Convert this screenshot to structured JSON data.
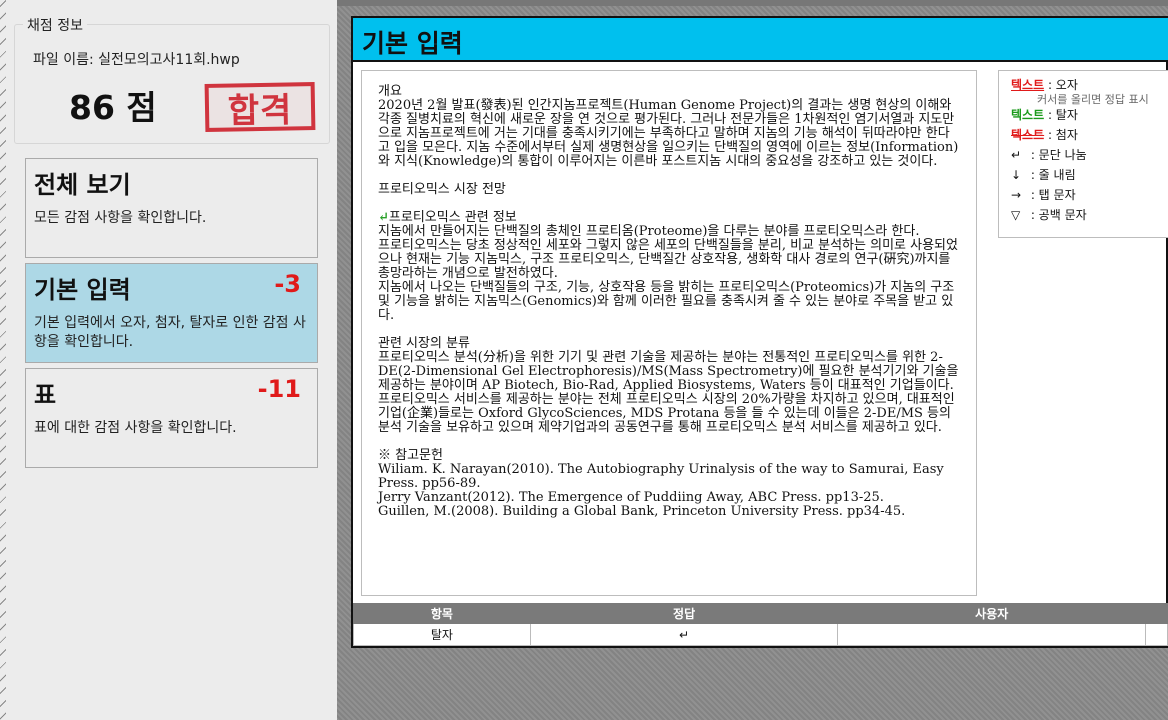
{
  "left": {
    "group_title": "채점 정보",
    "file_name": "파일 이름: 실전모의고사11회.hwp",
    "score": "86 점",
    "stamp": "합격",
    "cards": [
      {
        "title": "전체 보기",
        "penalty": "",
        "desc": "모든 감점 사항을 확인합니다."
      },
      {
        "title": "기본 입력",
        "penalty": "-3",
        "desc": "기본 입력에서 오자, 첨자, 탈자로 인한 감점 사항을 확인합니다."
      },
      {
        "title": "표",
        "penalty": "-11",
        "desc": "표에 대한 감점 사항을 확인합니다."
      }
    ]
  },
  "window": {
    "title": "기본 입력",
    "doc": {
      "p1_head": "개요",
      "p1": "2020년 2월 발표(發表)된 인간지놈프로젝트(Human Genome Project)의 결과는 생명 현상의 이해와 각종 질병치료의 혁신에 새로운 장을 연 것으로 평가된다. 그러나 전문가들은 1차원적인 염기서열과 지도만으로 지놈프로젝트에 거는 기대를 충족시키기에는 부족하다고 말하며 지놈의 기능 해석이 뒤따라야만 한다고 입을 모은다. 지놈 수준에서부터 실제 생명현상을 일으키는 단백질의 영역에 이르는 정보(Information)와 지식(Knowledge)의 통합이 이루어지는 이른바 포스트지놈 시대의 중요성을 강조하고 있는 것이다.",
      "p2_head": "프로티오믹스 시장 전망",
      "para_mark": "↵",
      "p3_head": "프로티오믹스 관련 정보",
      "p3a": "지놈에서 만들어지는 단백질의 총체인 프로티옴(Proteome)을 다루는 분야를 프로티오믹스라 한다.",
      "p3b": "프로티오믹스는 당초 정상적인 세포와 그렇지 않은 세포의 단백질들을 분리, 비교 분석하는 의미로 사용되었으나 현재는 기능 지놈믹스, 구조 프로티오믹스, 단백질간 상호작용, 생화학 대사 경로의 연구(硏究)까지를 총망라하는 개념으로 발전하였다.",
      "p3c": "지놈에서 나오는 단백질들의 구조, 기능, 상호작용 등을 밝히는 프로티오믹스(Proteomics)가 지놈의 구조 및 기능을 밝히는 지놈믹스(Genomics)와 함께 이러한 필요를 충족시켜 줄 수 있는 분야로 주목을 받고 있다.",
      "p4_head": "관련 시장의 분류",
      "p4a": "프로티오믹스 분석(分析)을 위한 기기 및 관련 기술을 제공하는 분야는 전통적인 프로티오믹스를 위한 2-DE(2-Dimensional Gel Electrophoresis)/MS(Mass Spectrometry)에 필요한 분석기기와 기술을 제공하는 분야이며 AP Biotech, Bio-Rad, Applied Biosystems, Waters 등이 대표적인 기업들이다.",
      "p4b": "프로티오믹스 서비스를 제공하는 분야는 전체 프로티오믹스 시장의 20%가량을 차지하고 있으며, 대표적인 기업(企業)들로는 Oxford GlycoSciences, MDS Protana 등을 들 수 있는데 이들은 2-DE/MS 등의 분석 기술을 보유하고 있으며 제약기업과의 공동연구를 통해 프로티오믹스 분석 서비스를 제공하고 있다.",
      "ref_head": "※ 참고문헌",
      "ref1": "Wiliam. K. Narayan(2010). The Autobiography Urinalysis of the way to Samurai, Easy Press. pp56-89.",
      "ref2": "Jerry Vanzant(2012). The Emergence of Puddiing Away, ABC Press. pp13-25.",
      "ref3": "Guillen, M.(2008). Building a Global Bank, Princeton University Press. pp34-45."
    },
    "legend": {
      "typo_text": "텍스트",
      "typo_label": " : 오자",
      "typo_hint": "커서를 올리면 정답 표시",
      "missing_text": "텍스트",
      "missing_label": " : 탈자",
      "extra_text": "텍스트",
      "extra_label": " : 첨자",
      "para_sym": "↵",
      "para_label": " : 문단 나눔",
      "line_sym": "↓",
      "line_label": " : 줄 내림",
      "tab_sym": "→",
      "tab_label": " : 탭 문자",
      "space_sym": "▽",
      "space_label": " : 공백 문자"
    },
    "table": {
      "headers": [
        "항목",
        "정답",
        "사용자"
      ],
      "rows": [
        [
          "탈자",
          "↵",
          ""
        ]
      ]
    }
  }
}
